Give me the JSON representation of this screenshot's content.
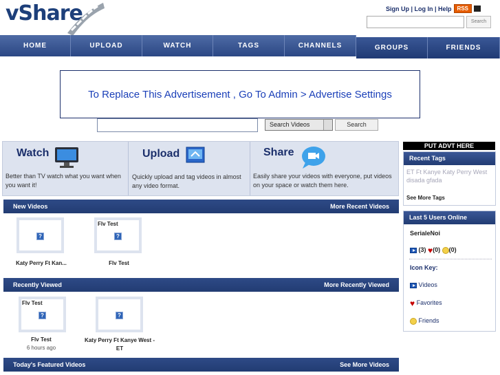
{
  "header": {
    "logo_text": "vShare",
    "links": [
      "Sign Up",
      "Log In",
      "Help"
    ],
    "rss_label": "RSS",
    "search_button": "Search"
  },
  "nav": [
    "HOME",
    "UPLOAD",
    "WATCH",
    "TAGS",
    "CHANNELS",
    "GROUPS",
    "FRIENDS"
  ],
  "ad": {
    "text": "To Replace This Advertisement , Go To Admin > Advertise Settings"
  },
  "search": {
    "select_value": "Search Videos",
    "button": "Search"
  },
  "features": {
    "watch": {
      "title": "Watch",
      "desc": "Better than TV watch what you want when you want it!"
    },
    "upload": {
      "title": "Upload",
      "desc": "Quickly upload and tag videos in almost any video format."
    },
    "share": {
      "title": "Share",
      "desc": "Easily share your videos with everyone, put videos on your space or watch them here."
    }
  },
  "new_videos": {
    "title": "New Videos",
    "more": "More Recent Videos",
    "items": [
      {
        "thumb_label": "",
        "title": "Katy Perry Ft Kan..."
      },
      {
        "thumb_label": "Flv Test",
        "title": "Flv Test"
      }
    ]
  },
  "recently_viewed": {
    "title": "Recently Viewed",
    "more": "More Recently Viewed",
    "items": [
      {
        "thumb_label": "Flv Test",
        "title": "Flv Test",
        "sub": "6 hours ago"
      },
      {
        "thumb_label": "",
        "title": "Katy Perry Ft Kanye West - ET"
      }
    ]
  },
  "featured": {
    "title": "Today's Featured Videos",
    "more": "See More Videos"
  },
  "sidebar": {
    "advt": "PUT ADVT HERE",
    "recent_tags": {
      "title": "Recent Tags",
      "tags": "ET Ft Kanye Katy Perry West disada gfada",
      "more": "See More Tags"
    },
    "users_online": {
      "title": "Last 5 Users Online",
      "user": "SerialeNoi",
      "videos_count": "(3)",
      "favorites_count": "(0)",
      "friends_count": "(0)",
      "icon_key": "Icon Key:",
      "key_videos": "Videos",
      "key_favorites": "Favorites",
      "key_friends": "Friends"
    }
  }
}
